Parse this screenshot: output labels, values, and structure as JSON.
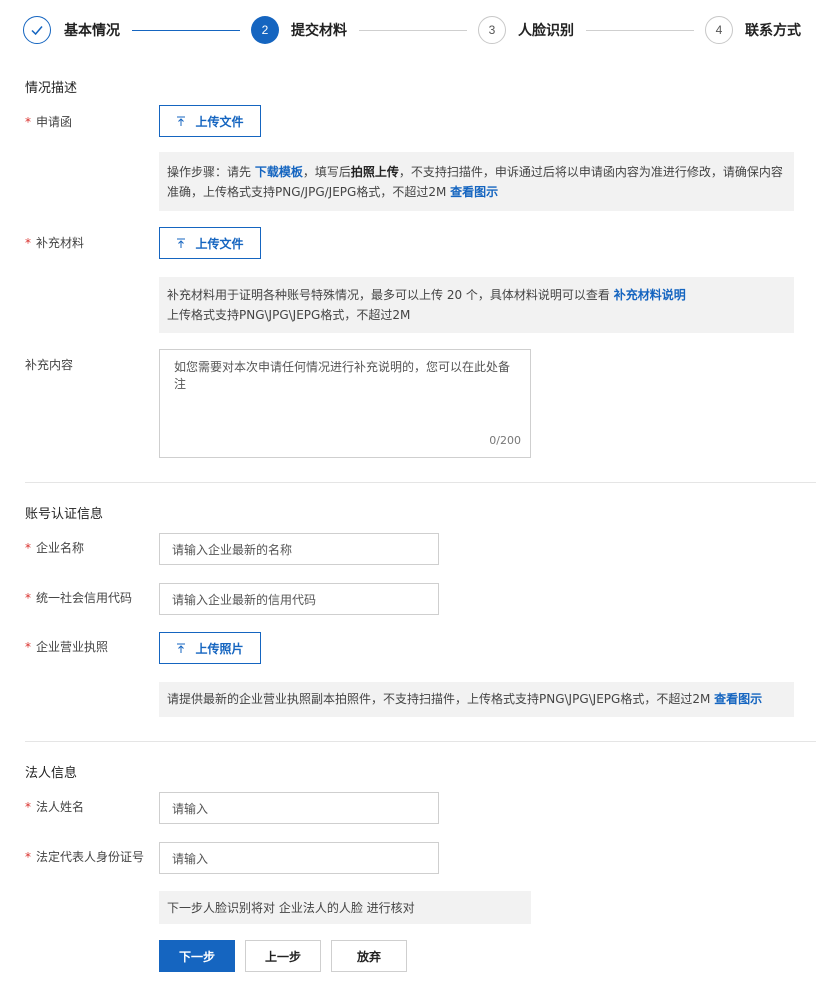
{
  "steps": [
    {
      "number": "",
      "label": "基本情况",
      "status": "done",
      "icon": "check-icon"
    },
    {
      "number": "2",
      "label": "提交材料",
      "status": "active"
    },
    {
      "number": "3",
      "label": "人脸识别",
      "status": "todo"
    },
    {
      "number": "4",
      "label": "联系方式",
      "status": "todo"
    }
  ],
  "situation": {
    "title": "情况描述",
    "letter": {
      "required_mark": "*",
      "label": "申请函",
      "upload_label": "上传文件",
      "info": {
        "prefix": "操作步骤：请先 ",
        "download_link": "下载模板",
        "mid1": "，填写后",
        "photo_bold": "拍照上传",
        "mid2": "，不支持扫描件，申诉通过后将以申请函内容为准进行修改，请确保内容准确，上传格式支持PNG/JPG/JEPG格式，不超过2M ",
        "example_link": "查看图示"
      }
    },
    "supplement": {
      "required_mark": "*",
      "label": "补充材料",
      "upload_label": "上传文件",
      "info": {
        "line1": "补充材料用于证明各种账号特殊情况，最多可以上传 20 个，具体材料说明可以查看 ",
        "link": "补充材料说明",
        "line2": "上传格式支持PNG\\JPG\\JEPG格式，不超过2M"
      }
    },
    "content": {
      "label": "补充内容",
      "placeholder": "如您需要对本次申请任何情况进行补充说明的，您可以在此处备注",
      "counter": "0/200"
    }
  },
  "account": {
    "title": "账号认证信息",
    "company_name": {
      "required_mark": "*",
      "label": "企业名称",
      "placeholder": "请输入企业最新的名称"
    },
    "credit_code": {
      "required_mark": "*",
      "label": "统一社会信用代码",
      "placeholder": "请输入企业最新的信用代码"
    },
    "license": {
      "required_mark": "*",
      "label": "企业营业执照",
      "upload_label": "上传照片",
      "info_text": "请提供最新的企业营业执照副本拍照件，不支持扫描件，上传格式支持PNG\\JPG\\JEPG格式，不超过2M ",
      "info_link": "查看图示"
    }
  },
  "legal": {
    "title": "法人信息",
    "name": {
      "required_mark": "*",
      "label": "法人姓名",
      "placeholder": "请输入"
    },
    "id_number": {
      "required_mark": "*",
      "label": "法定代表人身份证号",
      "placeholder": "请输入"
    },
    "notice": "下一步人脸识别将对 企业法人的人脸 进行核对"
  },
  "actions": {
    "next": "下一步",
    "prev": "上一步",
    "abandon": "放弃"
  },
  "colors": {
    "accent": "#1565c0",
    "required": "#d9302c",
    "info_bg": "#f2f2f2"
  }
}
